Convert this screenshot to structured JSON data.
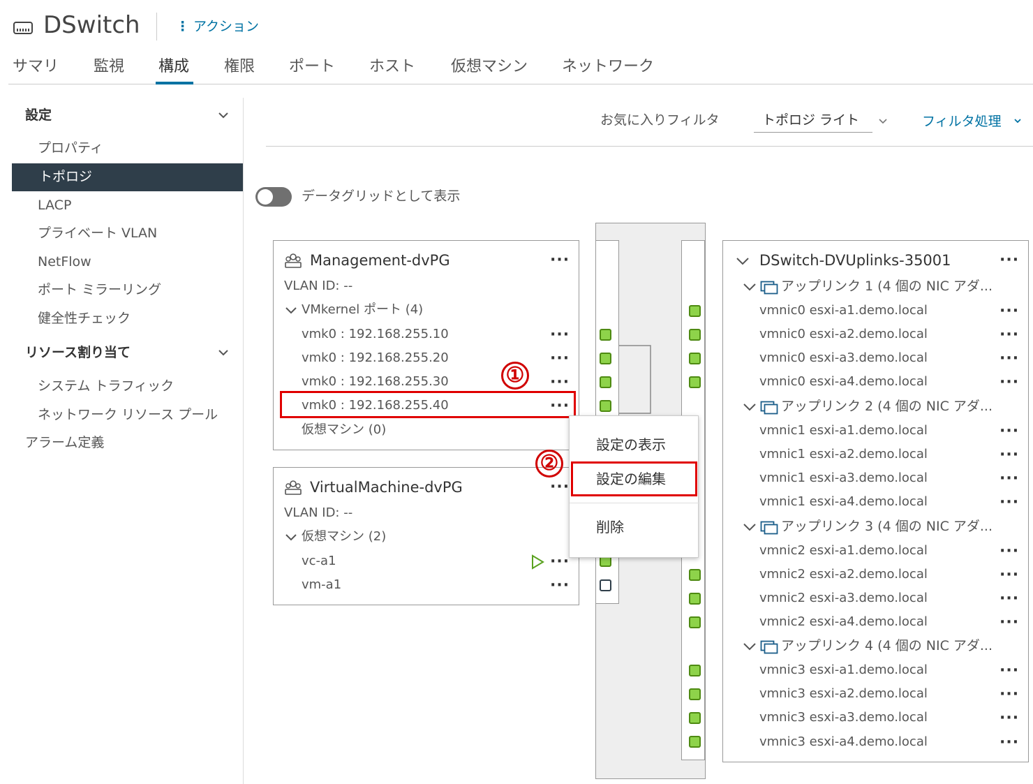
{
  "header": {
    "title": "DSwitch",
    "actions_label": "アクション"
  },
  "tabs": [
    "サマリ",
    "監視",
    "構成",
    "権限",
    "ポート",
    "ホスト",
    "仮想マシン",
    "ネットワーク"
  ],
  "sidebar": {
    "section1": "設定",
    "items1": [
      "プロパティ",
      "トポロジ",
      "LACP",
      "プライベート VLAN",
      "NetFlow",
      "ポート ミラーリング",
      "健全性チェック"
    ],
    "section2": "リソース割り当て",
    "items2": [
      "システム トラフィック",
      "ネットワーク リソース プール"
    ],
    "alarm": "アラーム定義"
  },
  "toolbar": {
    "favorites": "お気に入りフィルタ",
    "view_select": "トポロジ ライト",
    "filter": "フィルタ処理"
  },
  "toggle_label": "データグリッドとして表示",
  "management": {
    "title": "Management-dvPG",
    "vlan": "VLAN ID: --",
    "vmkernel": "VMkernel ポート (4)",
    "ports": [
      "vmk0 : 192.168.255.10",
      "vmk0 : 192.168.255.20",
      "vmk0 : 192.168.255.30",
      "vmk0 : 192.168.255.40"
    ],
    "vms": "仮想マシン (0)"
  },
  "virtualmachine": {
    "title": "VirtualMachine-dvPG",
    "vlan": "VLAN ID: --",
    "vms": "仮想マシン (2)",
    "vm_list": [
      "vc-a1",
      "vm-a1"
    ]
  },
  "context_menu": [
    "設定の表示",
    "設定の編集",
    "削除"
  ],
  "markers": [
    "①",
    "②"
  ],
  "uplinks": {
    "title": "DSwitch-DVUplinks-35001",
    "groups": [
      {
        "label": "アップリンク 1 (4 個の NIC アダ...",
        "nics": [
          "vmnic0 esxi-a1.demo.local",
          "vmnic0 esxi-a2.demo.local",
          "vmnic0 esxi-a3.demo.local",
          "vmnic0 esxi-a4.demo.local"
        ]
      },
      {
        "label": "アップリンク 2 (4 個の NIC アダ...",
        "nics": [
          "vmnic1 esxi-a1.demo.local",
          "vmnic1 esxi-a2.demo.local",
          "vmnic1 esxi-a3.demo.local",
          "vmnic1 esxi-a4.demo.local"
        ]
      },
      {
        "label": "アップリンク 3 (4 個の NIC アダ...",
        "nics": [
          "vmnic2 esxi-a1.demo.local",
          "vmnic2 esxi-a2.demo.local",
          "vmnic2 esxi-a3.demo.local",
          "vmnic2 esxi-a4.demo.local"
        ]
      },
      {
        "label": "アップリンク 4 (4 個の NIC アダ...",
        "nics": [
          "vmnic3 esxi-a1.demo.local",
          "vmnic3 esxi-a2.demo.local",
          "vmnic3 esxi-a3.demo.local",
          "vmnic3 esxi-a4.demo.local"
        ]
      }
    ]
  },
  "colors": {
    "accent": "#0072a3",
    "nav_active": "#2f3e4a",
    "highlight": "#e00000",
    "port_green": "#8ed34a"
  }
}
